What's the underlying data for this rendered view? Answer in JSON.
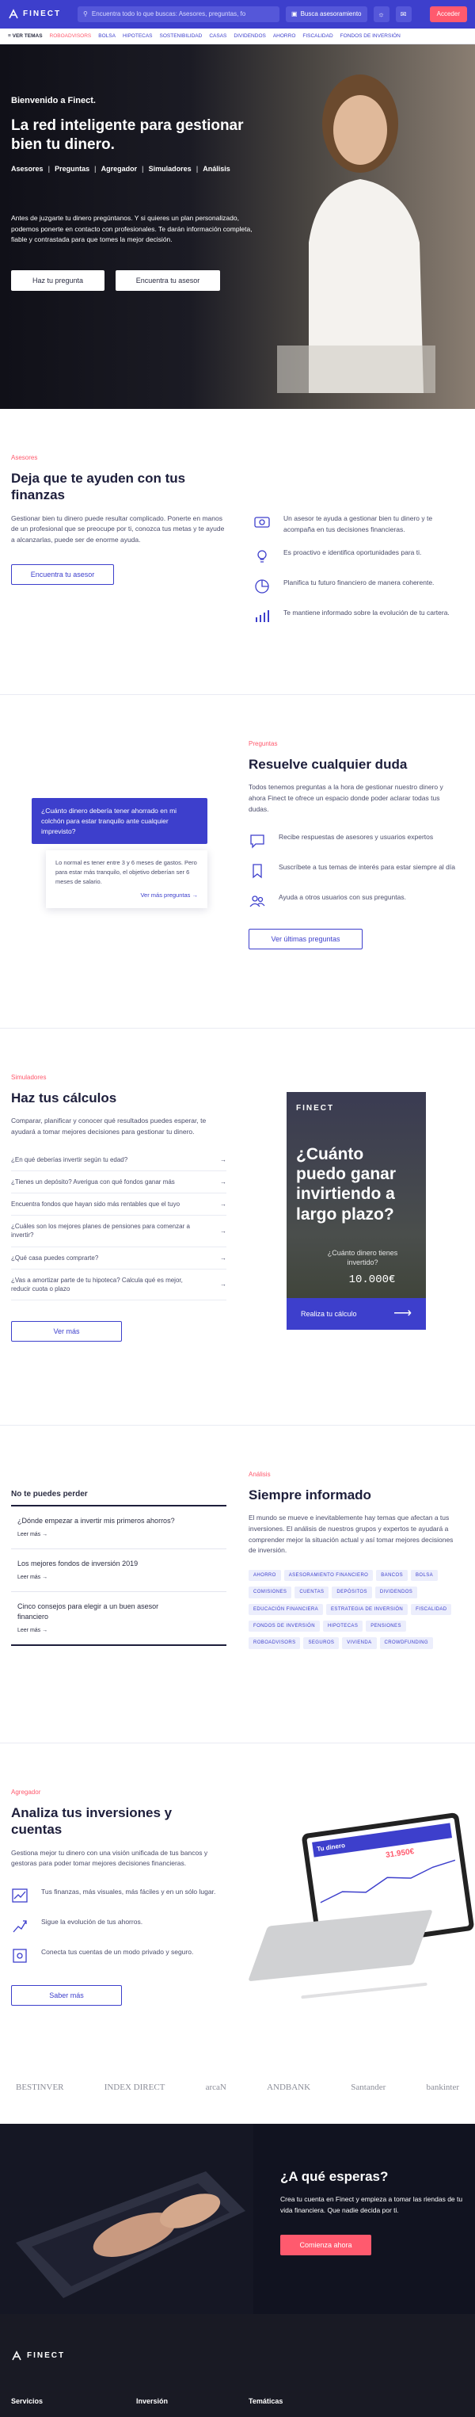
{
  "nav": {
    "brand": "FINECT",
    "search_placeholder": "Encuentra todo lo que buscas: Asesores, preguntas, fo",
    "advice_button": "Busca asesoramiento",
    "login_button": "Acceder"
  },
  "subnav": {
    "top_label": "VER TEMAS",
    "items": [
      "ROBOADVISORS",
      "BOLSA",
      "HIPOTECAS",
      "SOSTENIBILIDAD",
      "CASAS",
      "DIVIDENDOS",
      "AHORRO",
      "FISCALIDAD",
      "FONDOS DE INVERSIÓN"
    ]
  },
  "hero": {
    "welcome": "Bienvenido a Finect.",
    "title": "La red inteligente para gestionar bien tu dinero.",
    "tags": [
      "Asesores",
      "Preguntas",
      "Agregador",
      "Simuladores",
      "Análisis"
    ],
    "description": "Antes de juzgarte tu dinero pregúntanos. Y si quieres un plan personalizado, podemos ponerte en contacto con profesionales. Te darán información completa, fiable y contrastada para que tomes la mejor decisión.",
    "btn_question": "Haz tu pregunta",
    "btn_advisor": "Encuentra tu asesor"
  },
  "advisors": {
    "kicker": "Asesores",
    "title": "Deja que te ayuden con tus finanzas",
    "text": "Gestionar bien tu dinero puede resultar complicado. Ponerte en manos de un profesional que se preocupe por ti, conozca tus metas y te ayude a alcanzarlas, puede ser de enorme ayuda.",
    "button": "Encuentra tu asesor",
    "features": [
      {
        "icon": "money-icon",
        "text": "Un asesor te ayuda a gestionar bien tu dinero y te acompaña en tus decisiones financieras."
      },
      {
        "icon": "lightbulb-icon",
        "text": "Es proactivo e identifica oportunidades para ti."
      },
      {
        "icon": "pie-chart-icon",
        "text": "Planifica tu futuro financiero de manera coherente."
      },
      {
        "icon": "bar-chart-icon",
        "text": "Te mantiene informado sobre la evolución de tu cartera."
      }
    ]
  },
  "questions": {
    "kicker": "Preguntas",
    "title": "Resuelve cualquier duda",
    "text": "Todos tenemos preguntas a la hora de gestionar nuestro dinero y ahora Finect te ofrece un espacio donde poder aclarar todas tus dudas.",
    "bubble_question": "¿Cuánto dinero debería tener ahorrado en mi colchón para estar tranquilo ante cualquier imprevisto?",
    "bubble_answer": "Lo normal es tener entre 3 y 6 meses de gastos. Pero para estar más tranquilo, el objetivo deberían ser 6 meses de salario.",
    "bubble_link": "Ver más preguntas",
    "features": [
      {
        "icon": "chat-icon",
        "text": "Recibe respuestas de asesores y usuarios expertos"
      },
      {
        "icon": "bookmark-icon",
        "text": "Suscríbete a tus temas de interés para estar siempre al día"
      },
      {
        "icon": "community-icon",
        "text": "Ayuda a otros usuarios con sus preguntas."
      }
    ],
    "button": "Ver últimas preguntas"
  },
  "simulators": {
    "kicker": "Simuladores",
    "title": "Haz tus cálculos",
    "text": "Comparar, planificar y conocer qué resultados puedes esperar, te ayudará a tomar mejores decisiones para gestionar tu dinero.",
    "items": [
      "¿En qué deberías invertir según tu edad?",
      "¿Tienes un depósito? Averigua con qué fondos ganar más",
      "Encuentra fondos que hayan sido más rentables que el tuyo",
      "¿Cuáles son los mejores planes de pensiones para comenzar a invertir?",
      "¿Qué casa puedes comprarte?",
      "¿Vas a amortizar parte de tu hipoteca? Calcula qué es mejor, reducir cuota o plazo"
    ],
    "button": "Ver más",
    "card_brand": "FINECT",
    "card_title": "¿Cuánto puedo ganar invirtiendo a largo plazo?",
    "card_sub": "¿Cuánto dinero tienes invertido?",
    "card_value": "10.000€",
    "card_cta": "Realiza tu cálculo"
  },
  "dontmiss": {
    "title": "No te puedes perder",
    "items": [
      {
        "title": "¿Dónde empezar a invertir mis primeros ahorros?",
        "link": "Leer más"
      },
      {
        "title": "Los mejores fondos de inversión 2019",
        "link": "Leer más"
      },
      {
        "title": "Cinco consejos para elegir a un buen asesor financiero",
        "link": "Leer más"
      }
    ]
  },
  "analysis": {
    "kicker": "Análisis",
    "title": "Siempre informado",
    "text": "El mundo se mueve e inevitablemente hay temas que afectan a tus inversiones. El análisis de nuestros grupos y expertos te ayudará a comprender mejor la situación actual y así tomar mejores decisiones de inversión.",
    "tags": [
      "AHORRO",
      "ASESORAMIENTO FINANCIERO",
      "BANCOS",
      "BOLSA",
      "COMISIONES",
      "CUENTAS",
      "DEPÓSITOS",
      "DIVIDENDOS",
      "EDUCACIÓN FINANCIERA",
      "ESTRATEGIA DE INVERSIÓN",
      "FISCALIDAD",
      "FONDOS DE INVERSIÓN",
      "HIPOTECAS",
      "PENSIONES",
      "ROBOADVISORS",
      "SEGUROS",
      "VIVIENDA",
      "CROWDFUNDING"
    ]
  },
  "aggregator": {
    "kicker": "Agregador",
    "title": "Analiza tus inversiones y cuentas",
    "text": "Gestiona mejor tu dinero con una visión unificada de tus bancos y gestoras para poder tomar mejores decisiones financieras.",
    "features": [
      {
        "icon": "trend-icon",
        "text": "Tus finanzas, más visuales, más fáciles y en un sólo lugar."
      },
      {
        "icon": "savings-icon",
        "text": "Sigue la evolución de tus ahorros."
      },
      {
        "icon": "security-icon",
        "text": "Conecta tus cuentas de un modo privado y seguro."
      }
    ],
    "button": "Saber más",
    "tablet_title": "Tu dinero",
    "tablet_value": "31.950€"
  },
  "partners": [
    "BESTINVER",
    "INDEX DIRECT",
    "arcaN",
    "ANDBANK",
    "Santander",
    "bankinter"
  ],
  "cta": {
    "title": "¿A qué esperas?",
    "text": "Crea tu cuenta en Finect y empieza a tomar las riendas de tu vida financiera. Que nadie decida por ti.",
    "button": "Comienza ahora"
  },
  "footer": {
    "brand": "FINECT",
    "cols": [
      "Servicios",
      "Inversión",
      "Temáticas"
    ]
  },
  "colors": {
    "primary": "#3d3fcc",
    "accent": "#ff5a6e",
    "dark": "#111320"
  }
}
